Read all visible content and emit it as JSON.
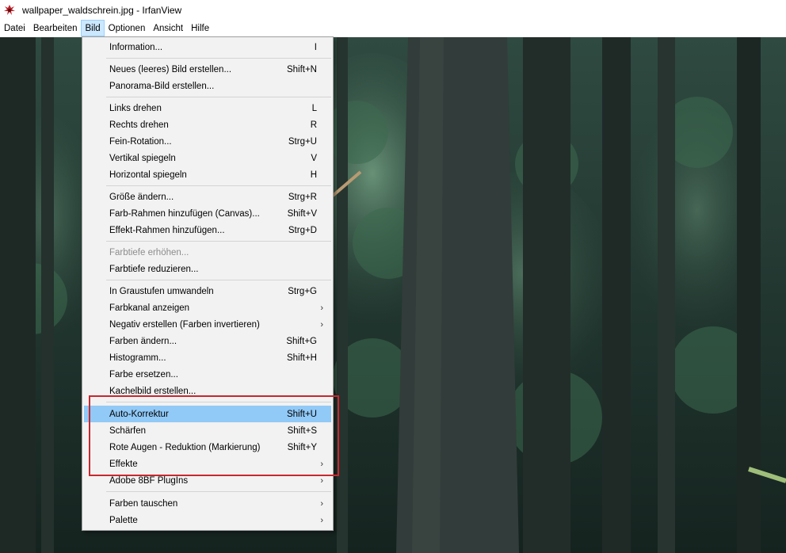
{
  "titlebar": {
    "title": "wallpaper_waldschrein.jpg - IrfanView",
    "icon": "irfanview-icon"
  },
  "menubar": {
    "items": [
      {
        "label": "Datei"
      },
      {
        "label": "Bearbeiten"
      },
      {
        "label": "Bild"
      },
      {
        "label": "Optionen"
      },
      {
        "label": "Ansicht"
      },
      {
        "label": "Hilfe"
      }
    ],
    "active": "Bild"
  },
  "dropdown": {
    "items": [
      {
        "label": "Information...",
        "shortcut": "I"
      },
      {
        "label": "Neues (leeres) Bild erstellen...",
        "shortcut": "Shift+N"
      },
      {
        "label": "Panorama-Bild erstellen...",
        "shortcut": ""
      },
      {
        "label": "Links drehen",
        "shortcut": "L"
      },
      {
        "label": "Rechts drehen",
        "shortcut": "R"
      },
      {
        "label": "Fein-Rotation...",
        "shortcut": "Strg+U"
      },
      {
        "label": "Vertikal spiegeln",
        "shortcut": "V"
      },
      {
        "label": "Horizontal spiegeln",
        "shortcut": "H"
      },
      {
        "label": "Größe ändern...",
        "shortcut": "Strg+R"
      },
      {
        "label": "Farb-Rahmen hinzufügen (Canvas)...",
        "shortcut": "Shift+V"
      },
      {
        "label": "Effekt-Rahmen hinzufügen...",
        "shortcut": "Strg+D"
      },
      {
        "label": "Farbtiefe erhöhen...",
        "shortcut": "",
        "disabled": true
      },
      {
        "label": "Farbtiefe reduzieren...",
        "shortcut": ""
      },
      {
        "label": "In Graustufen umwandeln",
        "shortcut": "Strg+G"
      },
      {
        "label": "Farbkanal anzeigen",
        "shortcut": "",
        "submenu": true
      },
      {
        "label": "Negativ erstellen (Farben invertieren)",
        "shortcut": "",
        "submenu": true
      },
      {
        "label": "Farben ändern...",
        "shortcut": "Shift+G"
      },
      {
        "label": "Histogramm...",
        "shortcut": "Shift+H"
      },
      {
        "label": "Farbe ersetzen...",
        "shortcut": ""
      },
      {
        "label": "Kachelbild erstellen...",
        "shortcut": ""
      },
      {
        "label": "Auto-Korrektur",
        "shortcut": "Shift+U",
        "highlighted": true
      },
      {
        "label": "Schärfen",
        "shortcut": "Shift+S"
      },
      {
        "label": "Rote Augen - Reduktion (Markierung)",
        "shortcut": "Shift+Y"
      },
      {
        "label": "Effekte",
        "shortcut": "",
        "submenu": true
      },
      {
        "label": "Adobe 8BF PlugIns",
        "shortcut": "",
        "submenu": true
      },
      {
        "label": "Farben tauschen",
        "shortcut": "",
        "submenu": true
      },
      {
        "label": "Palette",
        "shortcut": "",
        "submenu": true
      }
    ],
    "submenu_arrow": "›"
  },
  "colors": {
    "menu_bg": "#f2f2f2",
    "highlight": "#91c9f7",
    "active_menu": "#cce8ff",
    "annotation_box": "#c8282e"
  }
}
